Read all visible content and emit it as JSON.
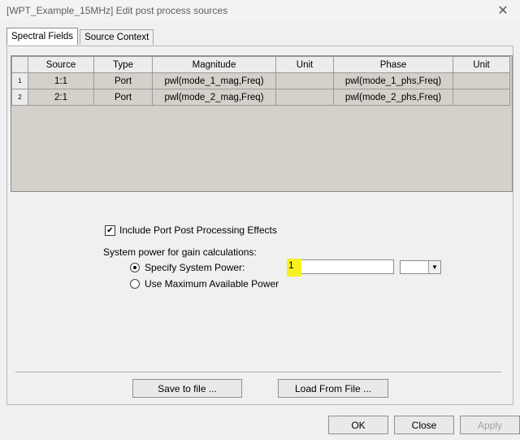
{
  "window": {
    "title": "[WPT_Example_15MHz]  Edit post process sources",
    "close_glyph": "✕"
  },
  "tabs": [
    {
      "label": "Spectral Fields",
      "active": true
    },
    {
      "label": "Source Context",
      "active": false
    }
  ],
  "table": {
    "columns": [
      "Source",
      "Type",
      "Magnitude",
      "Unit",
      "Phase",
      "Unit"
    ],
    "rows": [
      {
        "index": "1",
        "cells": [
          "1:1",
          "Port",
          "pwl(mode_1_mag,Freq)",
          "",
          "pwl(mode_1_phs,Freq)",
          ""
        ]
      },
      {
        "index": "2",
        "cells": [
          "2:1",
          "Port",
          "pwl(mode_2_mag,Freq)",
          "",
          "pwl(mode_2_phs,Freq)",
          ""
        ]
      }
    ]
  },
  "include_port_effects": {
    "label": "Include Port Post Processing Effects",
    "checked": true,
    "check_glyph": "✔"
  },
  "system_power": {
    "heading": "System power for gain calculations:",
    "options": [
      {
        "label": "Specify System Power:",
        "selected": true
      },
      {
        "label": "Use Maximum Available Power",
        "selected": false
      }
    ],
    "value": "1",
    "unit_value": "",
    "dropdown_glyph": "▼"
  },
  "file_buttons": {
    "save": "Save to file ...",
    "load": "Load From File ..."
  },
  "dialog_buttons": {
    "ok": "OK",
    "close": "Close",
    "apply": "Apply"
  },
  "colors": {
    "grid_background": "#d5d1ca",
    "highlight": "#f7f21f"
  }
}
